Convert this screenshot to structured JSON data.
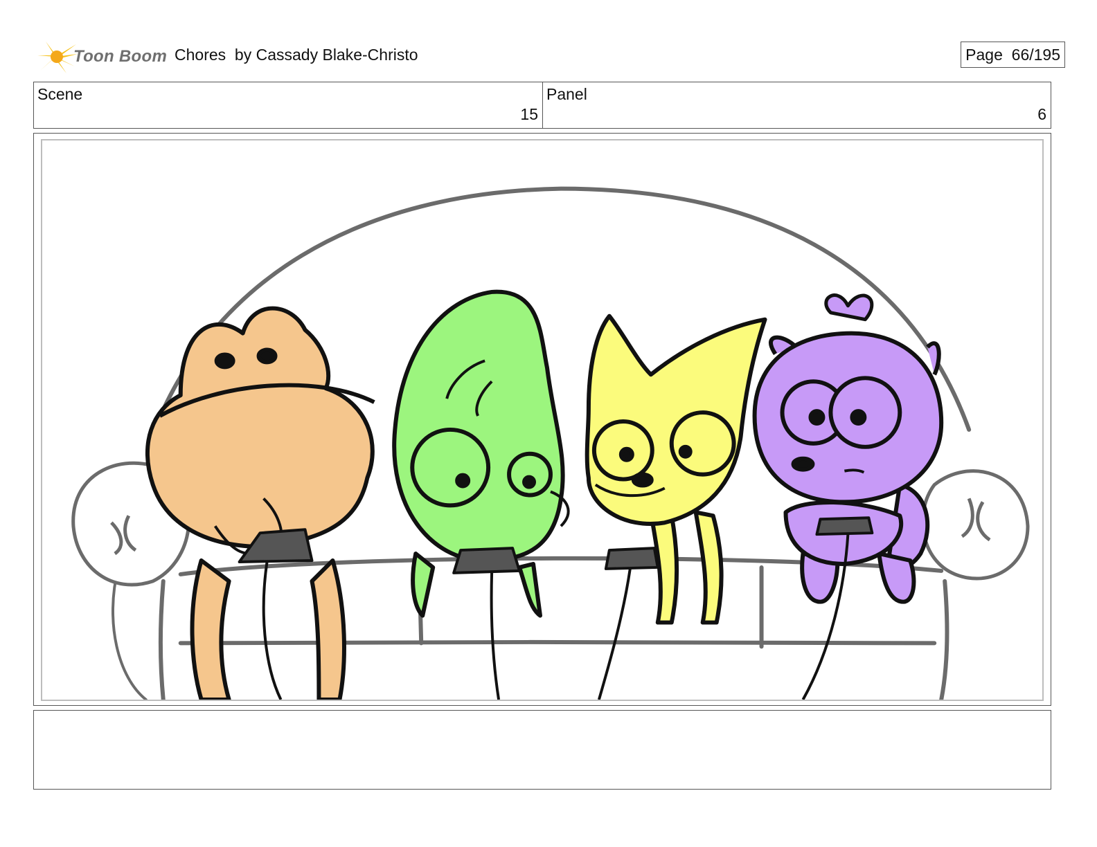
{
  "header": {
    "logo_text": "Toon Boom",
    "title": "Chores  by Cassady Blake-Christo",
    "page_label": "Page  66/195"
  },
  "info": {
    "scene_label": "Scene",
    "scene_value": "15",
    "panel_label": "Panel",
    "panel_value": "6"
  },
  "drawing": {
    "characters": [
      "orange-frog",
      "green-lizard",
      "yellow-fox",
      "purple-squirrel"
    ],
    "colors": {
      "frog": "#f5c68d",
      "lizard": "#9cf57e",
      "fox": "#fbfb7c",
      "squirrel": "#c79af7",
      "couch_line": "#6b6b6b",
      "controller": "#555555"
    }
  },
  "notes": {
    "text": ""
  }
}
